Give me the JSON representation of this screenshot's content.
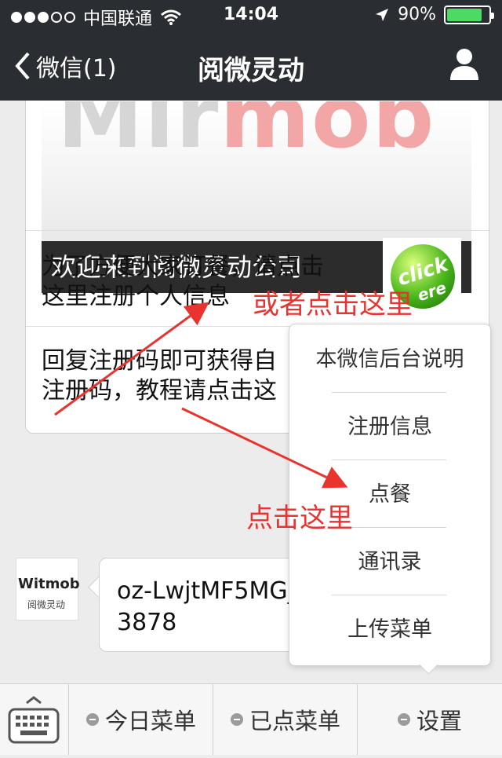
{
  "status_bar": {
    "carrier": "中国联通",
    "time": "14:04",
    "battery": "90%",
    "battery_level": 0.9
  },
  "nav": {
    "back_label": "微信(1)",
    "title": "阅微灵动"
  },
  "article": {
    "banner_text": "欢迎来到阅微灵动公司",
    "item1": [
      "为了方便大家订餐，请点击",
      "这里注册个人信息"
    ],
    "item2": [
      "回复注册码即可获得自",
      "注册码，教程请点击这"
    ],
    "thumb_text": "click",
    "thumb_text2": "ere"
  },
  "message": {
    "avatar_brand": "Witmob",
    "avatar_sub": "阅微灵动",
    "text": "oz-LwjtMF5MG_5LaJr3878"
  },
  "popup_menu": {
    "items": [
      "本微信后台说明",
      "注册信息",
      "点餐",
      "通讯录",
      "上传菜单"
    ]
  },
  "annotations": {
    "note1": "或者点击这里",
    "note2": "点击这里"
  },
  "bottom_bar": {
    "tabs": [
      "今日菜单",
      "已点菜单",
      "设置"
    ]
  },
  "colors": {
    "nav_bg": "#2a2d31",
    "annotation": "#e9332f",
    "battery": "#4cd964"
  }
}
